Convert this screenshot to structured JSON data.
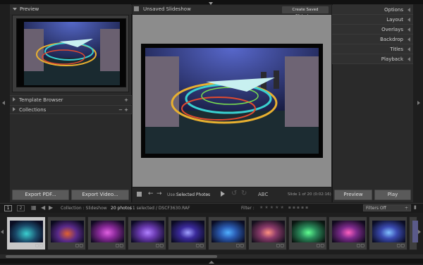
{
  "left": {
    "preview_title": "Preview",
    "template_browser": "Template Browser",
    "collections": "Collections",
    "export_pdf": "Export PDF...",
    "export_video": "Export Video..."
  },
  "center": {
    "title": "Unsaved Slideshow",
    "create_button": "Create Saved Slideshow",
    "use_label": "Use:",
    "use_value": "Selected Photos",
    "abc": "ABC",
    "slide_info": "Slide 1 of 20 (0:02:16)"
  },
  "right": {
    "options": "Options",
    "layout": "Layout",
    "overlays": "Overlays",
    "backdrop": "Backdrop",
    "titles": "Titles",
    "playback": "Playback",
    "preview_button": "Preview",
    "play_button": "Play"
  },
  "filmstrip_bar": {
    "page1": "1",
    "page2": "2",
    "source": "Collection : Slideshow",
    "count": "20 photos",
    "selection": "/ 1 selected / DSCF3630.RAF",
    "filter_label": "Filter :",
    "filters_off": "Filters Off"
  },
  "filmstrip": {
    "thumb_colors": [
      "#2a7a7a",
      "#5a2a8a",
      "#8a2a9a",
      "#6a3ab0",
      "#3a2a9a",
      "#2a5ab0",
      "#8a3a6a",
      "#2a8a5a",
      "#7a2a8a",
      "#3a4ab0",
      "#5a5a8a"
    ]
  }
}
